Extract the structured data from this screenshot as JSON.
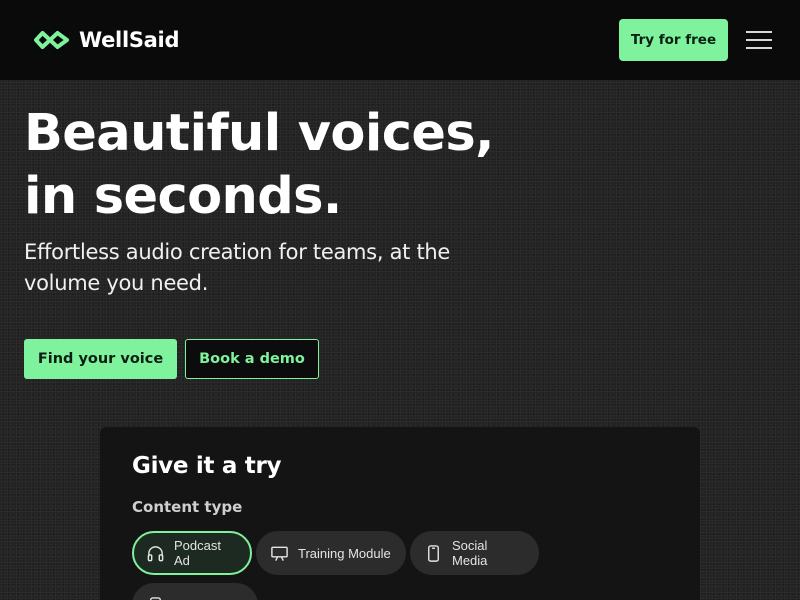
{
  "header": {
    "brand": "WellSaid",
    "try_free_label": "Try for free"
  },
  "hero": {
    "headline_line1": "Beautiful voices,",
    "headline_line2": "in seconds.",
    "subheadline": "Effortless audio creation for teams, at the volume you need.",
    "primary_cta": "Find your voice",
    "secondary_cta": "Book a demo"
  },
  "try_card": {
    "title": "Give it a try",
    "content_type_label": "Content type",
    "content_types": [
      {
        "label": "Podcast Ad",
        "icon": "headphones-icon",
        "selected": true
      },
      {
        "label": "Training Module",
        "icon": "presentation-icon",
        "selected": false
      },
      {
        "label": "Social Media",
        "icon": "phone-icon",
        "selected": false
      },
      {
        "label": "",
        "icon": "phone-icon",
        "selected": false
      }
    ]
  },
  "colors": {
    "accent": "#7ef29d",
    "header_bg": "#0a0a0a",
    "card_bg": "#141414",
    "chip_bg": "#2c2c2c"
  }
}
